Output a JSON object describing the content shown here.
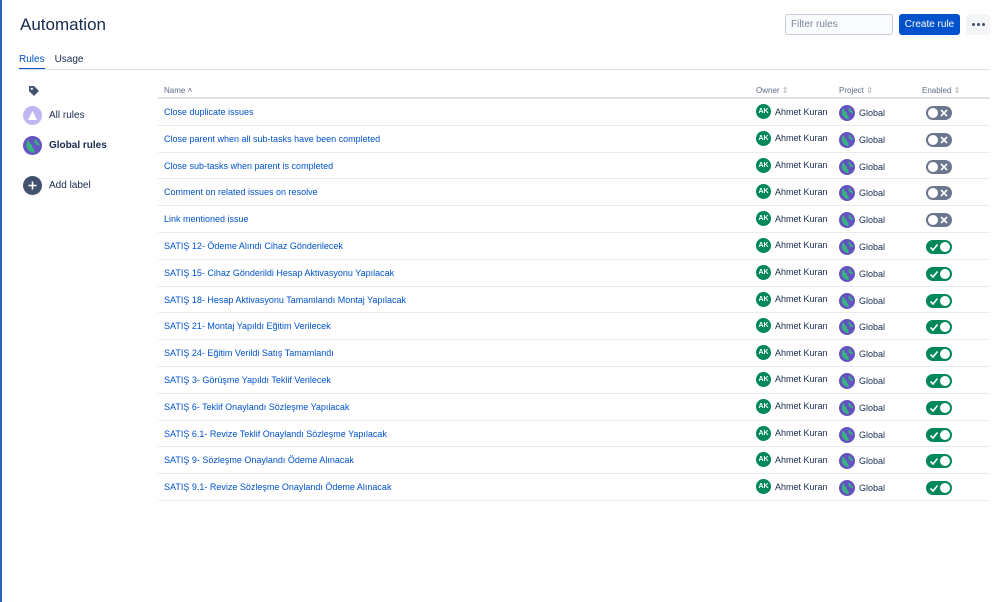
{
  "header": {
    "title": "Automation",
    "filter_placeholder": "Filter rules",
    "create_label": "Create rule"
  },
  "tabs": [
    {
      "label": "Rules",
      "active": true
    },
    {
      "label": "Usage",
      "active": false
    }
  ],
  "sidebar": {
    "items": [
      {
        "label": "All rules",
        "icon": "all-rules-icon"
      },
      {
        "label": "Global rules",
        "icon": "globe-icon"
      },
      {
        "label": "Add label",
        "icon": "plus-icon"
      }
    ]
  },
  "table": {
    "columns": [
      "Name",
      "Owner",
      "Project",
      "Enabled"
    ],
    "rows": [
      {
        "name": "Close duplicate issues",
        "owner_initials": "AK",
        "owner": "Ahmet Kuran",
        "project": "Global",
        "enabled": false
      },
      {
        "name": "Close parent when all sub-tasks have been completed",
        "owner_initials": "AK",
        "owner": "Ahmet Kuran",
        "project": "Global",
        "enabled": false
      },
      {
        "name": "Close sub-tasks when parent is completed",
        "owner_initials": "AK",
        "owner": "Ahmet Kuran",
        "project": "Global",
        "enabled": false
      },
      {
        "name": "Comment on related issues on resolve",
        "owner_initials": "AK",
        "owner": "Ahmet Kuran",
        "project": "Global",
        "enabled": false
      },
      {
        "name": "Link mentioned issue",
        "owner_initials": "AK",
        "owner": "Ahmet Kuran",
        "project": "Global",
        "enabled": false
      },
      {
        "name": "SATIŞ 12- Ödeme Alındı Cihaz Gönderilecek",
        "owner_initials": "AK",
        "owner": "Ahmet Kuran",
        "project": "Global",
        "enabled": true
      },
      {
        "name": "SATIŞ 15- Cihaz Gönderildi Hesap Aktivasyonu Yapılacak",
        "owner_initials": "AK",
        "owner": "Ahmet Kuran",
        "project": "Global",
        "enabled": true
      },
      {
        "name": "SATIŞ 18- Hesap Aktivasyonu Tamamlandı Montaj Yapılacak",
        "owner_initials": "AK",
        "owner": "Ahmet Kuran",
        "project": "Global",
        "enabled": true
      },
      {
        "name": "SATIŞ 21- Montaj Yapıldı Eğitim Verilecek",
        "owner_initials": "AK",
        "owner": "Ahmet Kuran",
        "project": "Global",
        "enabled": true
      },
      {
        "name": "SATIŞ 24- Eğitim Verildi Satış Tamamlandı",
        "owner_initials": "AK",
        "owner": "Ahmet Kuran",
        "project": "Global",
        "enabled": true
      },
      {
        "name": "SATIŞ 3- Görüşme Yapıldı Teklif Verilecek",
        "owner_initials": "AK",
        "owner": "Ahmet Kuran",
        "project": "Global",
        "enabled": true
      },
      {
        "name": "SATIŞ 6- Teklif Onaylandı Sözleşme Yapılacak",
        "owner_initials": "AK",
        "owner": "Ahmet Kuran",
        "project": "Global",
        "enabled": true
      },
      {
        "name": "SATIŞ 6.1- Revize Teklif Onaylandı Sözleşme Yapılacak",
        "owner_initials": "AK",
        "owner": "Ahmet Kuran",
        "project": "Global",
        "enabled": true
      },
      {
        "name": "SATIŞ 9- Sözleşme Onaylandı Ödeme Alınacak",
        "owner_initials": "AK",
        "owner": "Ahmet Kuran",
        "project": "Global",
        "enabled": true
      },
      {
        "name": "SATIŞ 9.1- Revize Sözleşme Onaylandı Ödeme Alınacak",
        "owner_initials": "AK",
        "owner": "Ahmet Kuran",
        "project": "Global",
        "enabled": true
      }
    ]
  },
  "colors": {
    "brand": "#0052cc",
    "toggle_on": "#00875a",
    "toggle_off": "#6b778c",
    "avatar": "#00875a"
  }
}
